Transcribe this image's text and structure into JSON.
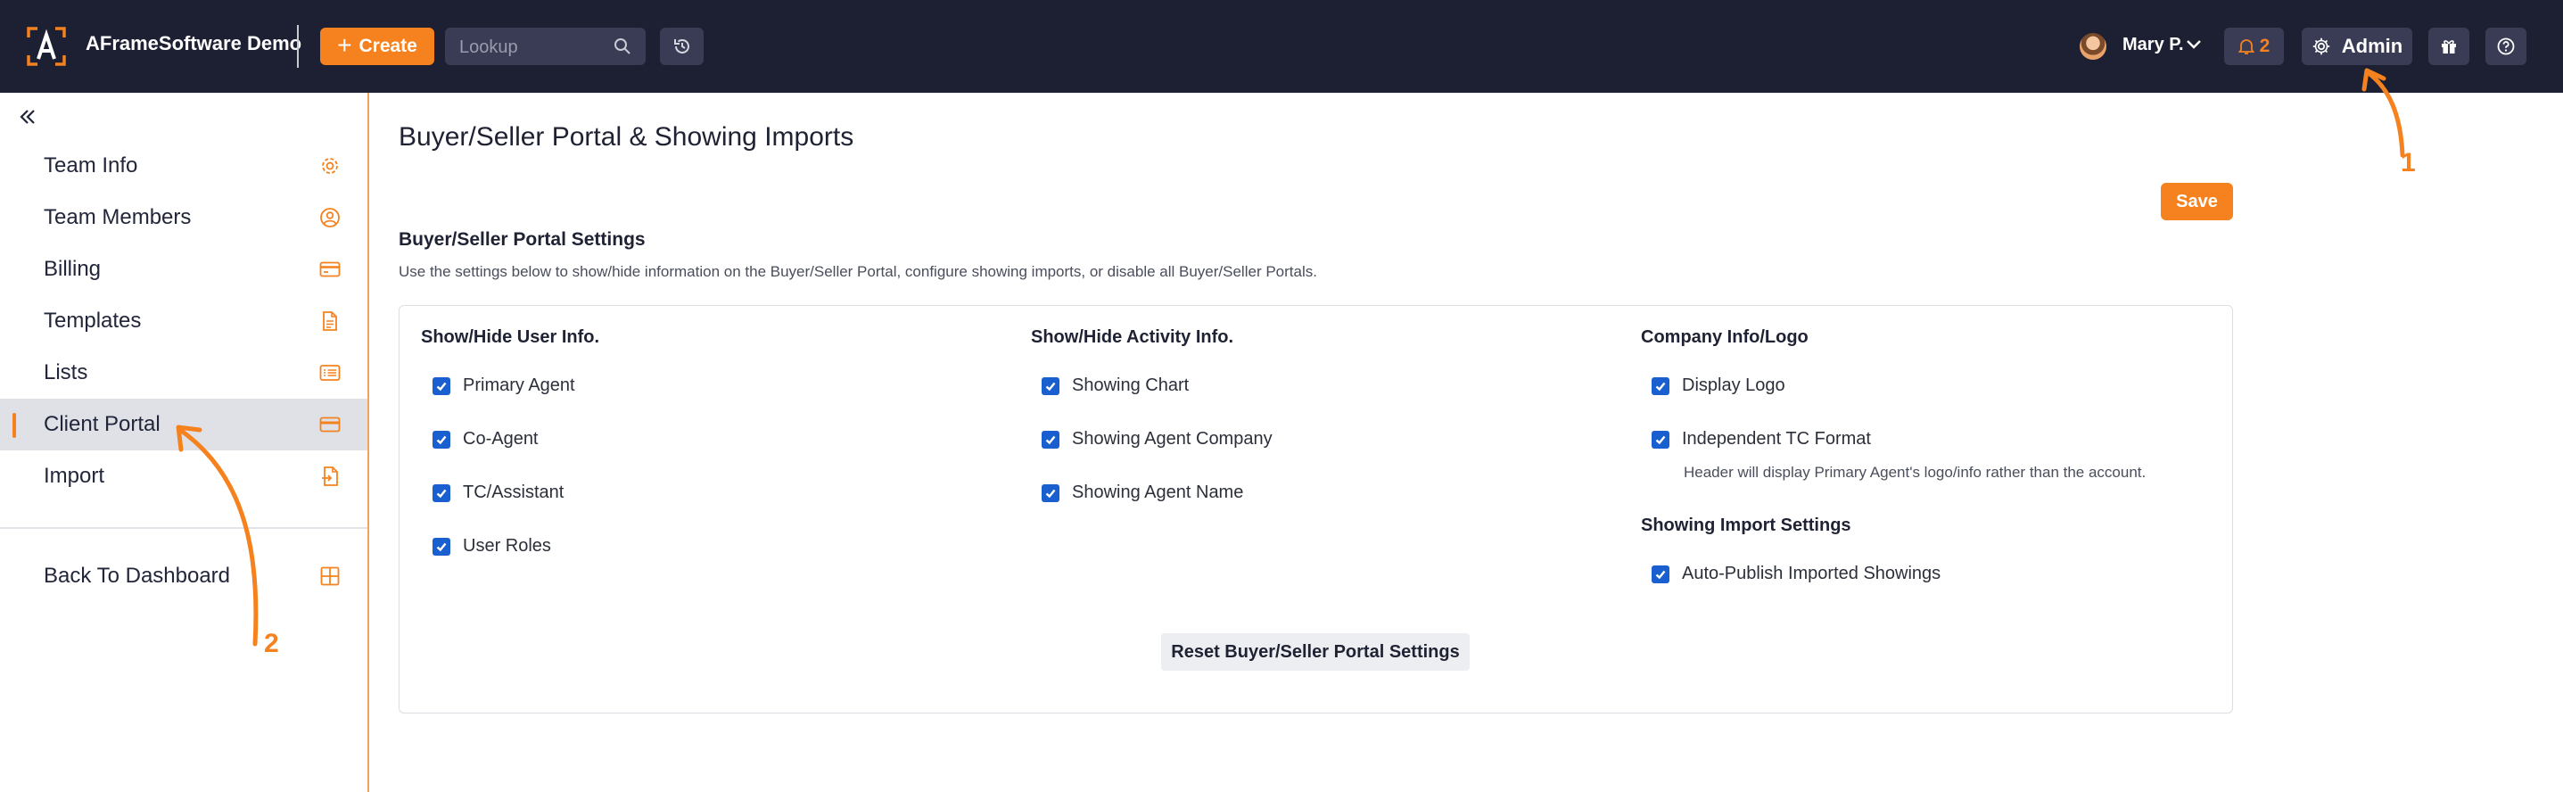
{
  "topbar": {
    "brand": "AFrameSoftware Demo",
    "create_label": "Create",
    "lookup_placeholder": "Lookup",
    "user_name": "Mary P.",
    "notification_count": "2",
    "admin_label": "Admin",
    "icons": [
      "logo-icon",
      "plus-icon",
      "search-icon",
      "history-icon",
      "chevron-down-icon",
      "bell-icon",
      "gear-icon",
      "gift-icon",
      "help-icon"
    ]
  },
  "sidebar": {
    "items": [
      {
        "label": "Team Info",
        "icon": "gear-icon"
      },
      {
        "label": "Team Members",
        "icon": "user-circle-icon"
      },
      {
        "label": "Billing",
        "icon": "credit-card-icon"
      },
      {
        "label": "Templates",
        "icon": "document-icon"
      },
      {
        "label": "Lists",
        "icon": "list-icon"
      },
      {
        "label": "Client Portal",
        "icon": "card-icon",
        "active": true
      },
      {
        "label": "Import",
        "icon": "import-icon"
      }
    ],
    "back_label": "Back To Dashboard"
  },
  "main": {
    "title": "Buyer/Seller Portal & Showing Imports",
    "save_label": "Save",
    "section_title": "Buyer/Seller Portal Settings",
    "section_desc": "Use the settings below to show/hide information on the Buyer/Seller Portal, configure showing imports, or disable all Buyer/Seller Portals.",
    "columns": [
      {
        "heading": "Show/Hide User Info.",
        "options": [
          {
            "label": "Primary Agent",
            "checked": true
          },
          {
            "label": "Co-Agent",
            "checked": true
          },
          {
            "label": "TC/Assistant",
            "checked": true
          },
          {
            "label": "User Roles",
            "checked": true
          }
        ]
      },
      {
        "heading": "Show/Hide Activity Info.",
        "options": [
          {
            "label": "Showing Chart",
            "checked": true
          },
          {
            "label": "Showing Agent Company",
            "checked": true
          },
          {
            "label": "Showing Agent Name",
            "checked": true
          }
        ]
      },
      {
        "heading": "Company Info/Logo",
        "options": [
          {
            "label": "Display Logo",
            "checked": true
          },
          {
            "label": "Independent TC Format",
            "checked": true
          }
        ],
        "note": "Header will display Primary Agent's logo/info rather than the account."
      }
    ],
    "import_heading": "Showing Import Settings",
    "import_options": [
      {
        "label": "Auto-Publish Imported Showings",
        "checked": true
      }
    ],
    "reset_label": "Reset Buyer/Seller Portal Settings"
  },
  "annotations": {
    "marker_1": "1",
    "marker_2": "2"
  },
  "colors": {
    "accent": "#f5821f",
    "topbar": "#1d1f33",
    "checkbox": "#1a5fd0",
    "active_item": "#dfe1e6"
  }
}
